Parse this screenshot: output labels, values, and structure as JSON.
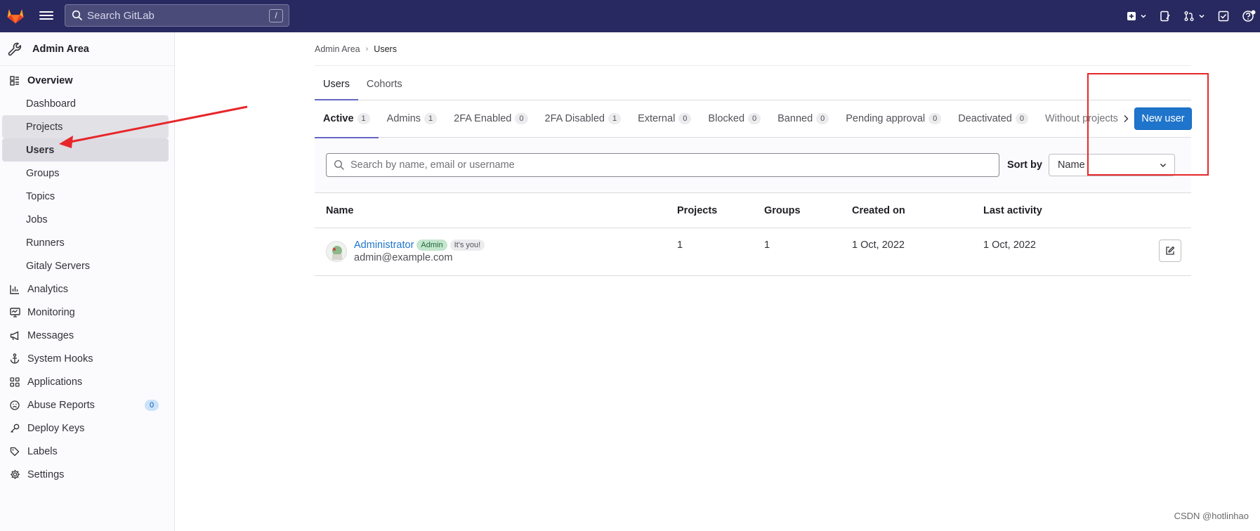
{
  "topbar": {
    "search_placeholder": "Search GitLab",
    "search_shortcut": "/"
  },
  "sidebar": {
    "header": "Admin Area",
    "overview": "Overview",
    "items": [
      {
        "label": "Dashboard"
      },
      {
        "label": "Projects"
      },
      {
        "label": "Users"
      },
      {
        "label": "Groups"
      },
      {
        "label": "Topics"
      },
      {
        "label": "Jobs"
      },
      {
        "label": "Runners"
      },
      {
        "label": "Gitaly Servers"
      }
    ],
    "sections": [
      {
        "label": "Analytics",
        "icon": "chart-icon"
      },
      {
        "label": "Monitoring",
        "icon": "monitor-icon"
      },
      {
        "label": "Messages",
        "icon": "bullhorn-icon"
      },
      {
        "label": "System Hooks",
        "icon": "anchor-icon"
      },
      {
        "label": "Applications",
        "icon": "grid-icon"
      },
      {
        "label": "Abuse Reports",
        "icon": "sad-face-icon",
        "badge": "0"
      },
      {
        "label": "Deploy Keys",
        "icon": "key-icon"
      },
      {
        "label": "Labels",
        "icon": "label-icon"
      },
      {
        "label": "Settings",
        "icon": "gear-icon"
      }
    ]
  },
  "breadcrumb": {
    "root": "Admin Area",
    "current": "Users"
  },
  "subtabs": [
    "Users",
    "Cohorts"
  ],
  "filters": [
    {
      "label": "Active",
      "count": "1"
    },
    {
      "label": "Admins",
      "count": "1"
    },
    {
      "label": "2FA Enabled",
      "count": "0"
    },
    {
      "label": "2FA Disabled",
      "count": "1"
    },
    {
      "label": "External",
      "count": "0"
    },
    {
      "label": "Blocked",
      "count": "0"
    },
    {
      "label": "Banned",
      "count": "0"
    },
    {
      "label": "Pending approval",
      "count": "0"
    },
    {
      "label": "Deactivated",
      "count": "0"
    },
    {
      "label": "Without projects"
    }
  ],
  "new_user_label": "New user",
  "user_search_placeholder": "Search by name, email or username",
  "sort": {
    "label": "Sort by",
    "value": "Name"
  },
  "table": {
    "headers": {
      "name": "Name",
      "projects": "Projects",
      "groups": "Groups",
      "created": "Created on",
      "activity": "Last activity"
    },
    "rows": [
      {
        "name": "Administrator",
        "badge_admin": "Admin",
        "badge_you": "It's you!",
        "email": "admin@example.com",
        "projects": "1",
        "groups": "1",
        "created": "1 Oct, 2022",
        "activity": "1 Oct, 2022"
      }
    ]
  },
  "watermark": "CSDN @hotlinhao",
  "colors": {
    "topbar": "#292961",
    "primary_button": "#1f75cb",
    "annotation": "#e8262a"
  }
}
